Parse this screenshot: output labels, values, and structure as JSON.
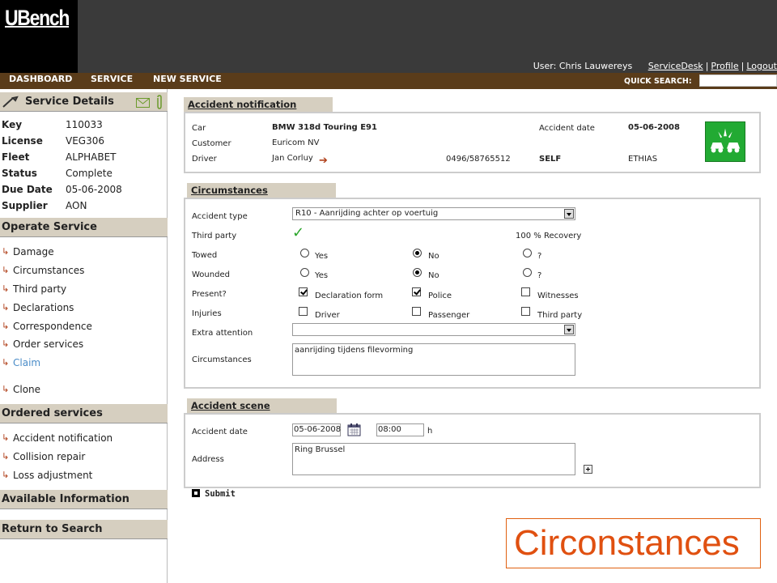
{
  "app": {
    "logo": "UBench"
  },
  "header": {
    "user_label": "User:",
    "user_name": "Chris Lauwereys",
    "links": [
      "ServiceDesk",
      "Profile",
      "Logout"
    ],
    "separator": "|"
  },
  "nav": {
    "items": [
      "DASHBOARD",
      "SERVICE",
      "NEW SERVICE"
    ],
    "quick_search_label": "QUICK SEARCH:",
    "quick_search_value": ""
  },
  "sidebar": {
    "details_title": "Service Details",
    "details": [
      {
        "key": "Key",
        "value": "110033"
      },
      {
        "key": "License",
        "value": "VEG306"
      },
      {
        "key": "Fleet",
        "value": "ALPHABET"
      },
      {
        "key": "Status",
        "value": "Complete"
      },
      {
        "key": "Due Date",
        "value": "05-06-2008"
      },
      {
        "key": "Supplier",
        "value": "AON"
      }
    ],
    "operate_title": "Operate Service",
    "operate_items": [
      "Damage",
      "Circumstances",
      "Third party",
      "Declarations",
      "Correspondence",
      "Order services",
      "Claim",
      "Clone"
    ],
    "arrow_glyph": "↳",
    "ordered_title": "Ordered services",
    "ordered_items": [
      "Accident notification",
      "Collision repair",
      "Loss adjustment"
    ],
    "available_title": "Available Information",
    "return_title": "Return to Search"
  },
  "notification": {
    "tab": "Accident notification",
    "car_label": "Car",
    "car_value": "BMW 318d Touring E91",
    "customer_label": "Customer",
    "customer_value": "Euricom NV",
    "driver_label": "Driver",
    "driver_value": "Jan Corluy",
    "driver_phone": "0496/58765512",
    "driver_self": "SELF",
    "accident_date_label": "Accident date",
    "accident_date_value": "05-06-2008",
    "insurer": "ETHIAS"
  },
  "circumstances": {
    "tab": "Circumstances",
    "accident_type_label": "Accident type",
    "accident_type_value": "R10 - Aanrijding achter op voertuig",
    "third_party_label": "Third party",
    "third_party_mark": "✓",
    "recovery": "100 % Recovery",
    "towed_label": "Towed",
    "wounded_label": "Wounded",
    "opt_yes": "Yes",
    "opt_no": "No",
    "opt_unknown": "?",
    "towed_selected": "No",
    "wounded_selected": "No",
    "present_label": "Present?",
    "present_options": [
      {
        "label": "Declaration form",
        "checked": true
      },
      {
        "label": "Police",
        "checked": true
      },
      {
        "label": "Witnesses",
        "checked": false
      }
    ],
    "injuries_label": "Injuries",
    "injuries_options": [
      {
        "label": "Driver",
        "checked": false
      },
      {
        "label": "Passenger",
        "checked": false
      },
      {
        "label": "Third party",
        "checked": false
      }
    ],
    "extra_attention_label": "Extra attention",
    "extra_attention_value": "",
    "circumstances_label": "Circumstances",
    "circumstances_value": "aanrijding tijdens filevorming"
  },
  "scene": {
    "tab": "Accident scene",
    "date_label": "Accident date",
    "date_value": "05-06-2008",
    "time_value": "08:00",
    "time_unit": "h",
    "address_label": "Address",
    "address_value": "Ring Brussel"
  },
  "submit_label": "Submit",
  "caption": "Circonstances",
  "colors": {
    "nav_bg": "#5a3c1a",
    "section_bg": "#d6cfc0",
    "accent_link": "#4a8cc8",
    "caption": "#e05010",
    "badge": "#22aa33"
  }
}
